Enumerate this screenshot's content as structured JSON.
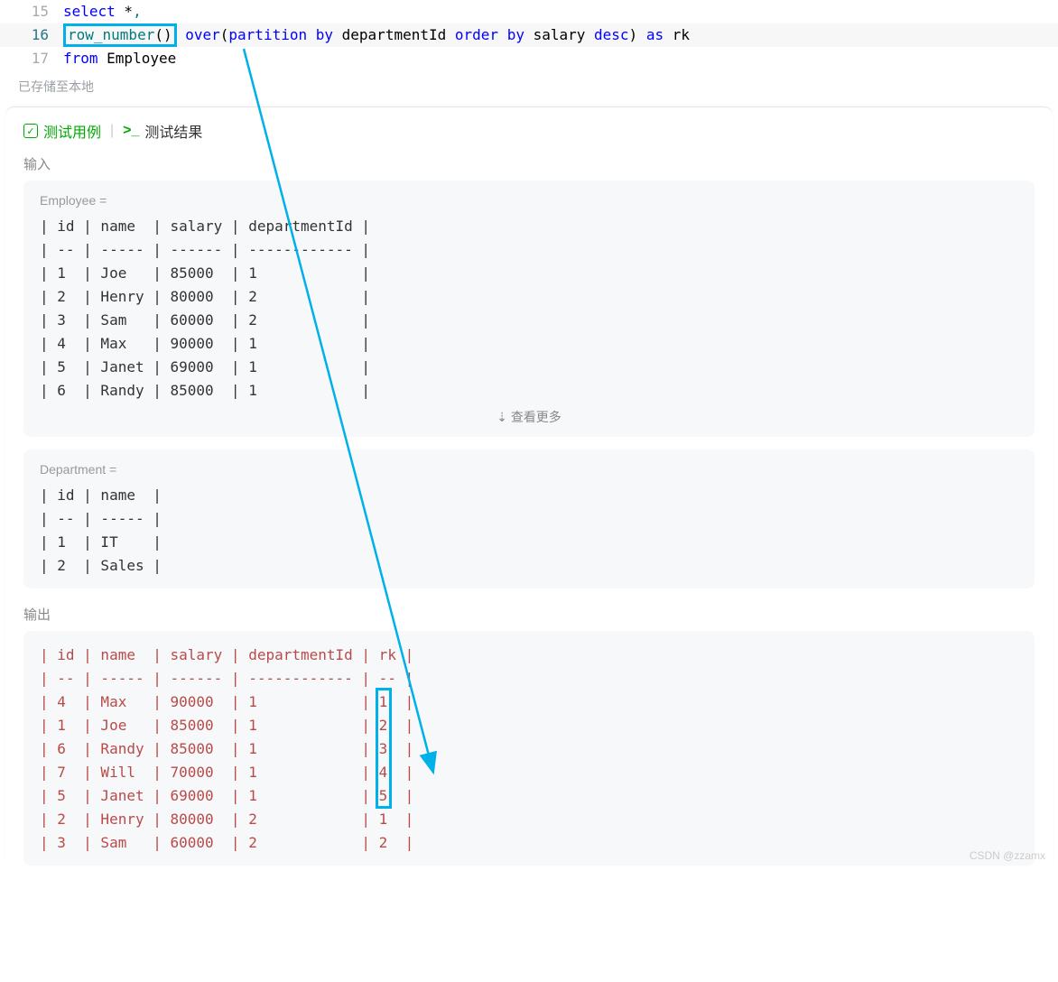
{
  "editor": {
    "lines": [
      {
        "num": "15",
        "tokens": [
          [
            "kw-blue",
            "select"
          ],
          [
            "kw-black",
            " *"
          ],
          [
            "kw-teal",
            ","
          ]
        ]
      },
      {
        "num": "16",
        "highlight": true,
        "tokens_pre": "    ",
        "boxed": "row_number()",
        "tokens_post": [
          [
            "kw-black",
            " "
          ],
          [
            "kw-blue",
            "over"
          ],
          [
            "kw-black",
            "("
          ],
          [
            "kw-blue",
            "partition"
          ],
          [
            "kw-black",
            " "
          ],
          [
            "kw-blue",
            "by"
          ],
          [
            "kw-black",
            " departmentId "
          ],
          [
            "kw-blue",
            "order"
          ],
          [
            "kw-black",
            " "
          ],
          [
            "kw-blue",
            "by"
          ],
          [
            "kw-black",
            " salary "
          ],
          [
            "kw-blue",
            "desc"
          ],
          [
            "kw-black",
            ") "
          ],
          [
            "kw-blue",
            "as"
          ],
          [
            "kw-black",
            " rk"
          ]
        ]
      },
      {
        "num": "17",
        "tokens": [
          [
            "kw-blue",
            "from"
          ],
          [
            "kw-black",
            " Employee"
          ]
        ]
      }
    ]
  },
  "status": "已存储至本地",
  "tabs": {
    "testcase": "测试用例",
    "result": "测试结果"
  },
  "sections": {
    "input": "输入",
    "output": "输出"
  },
  "employee": {
    "title": "Employee =",
    "header": "| id | name  | salary | departmentId |",
    "sep": "| -- | ----- | ------ | ------------ |",
    "rows": [
      "| 1  | Joe   | 85000  | 1            |",
      "| 2  | Henry | 80000  | 2            |",
      "| 3  | Sam   | 60000  | 2            |",
      "| 4  | Max   | 90000  | 1            |",
      "| 5  | Janet | 69000  | 1            |",
      "| 6  | Randy | 85000  | 1            |"
    ],
    "more": "查看更多"
  },
  "department": {
    "title": "Department =",
    "header": "| id | name  |",
    "sep": "| -- | ----- |",
    "rows": [
      "| 1  | IT    |",
      "| 2  | Sales |"
    ]
  },
  "output": {
    "header": "| id | name  | salary | departmentId | rk |",
    "sep": "| -- | ----- | ------ | ------------ | -- |",
    "rows": [
      "| 4  | Max   | 90000  | 1            | 1  |",
      "| 1  | Joe   | 85000  | 1            | 2  |",
      "| 6  | Randy | 85000  | 1            | 3  |",
      "| 7  | Will  | 70000  | 1            | 4  |",
      "| 5  | Janet | 69000  | 1            | 5  |",
      "| 2  | Henry | 80000  | 2            | 1  |",
      "| 3  | Sam   | 60000  | 2            | 2  |"
    ]
  },
  "watermark": "CSDN @zzamx"
}
